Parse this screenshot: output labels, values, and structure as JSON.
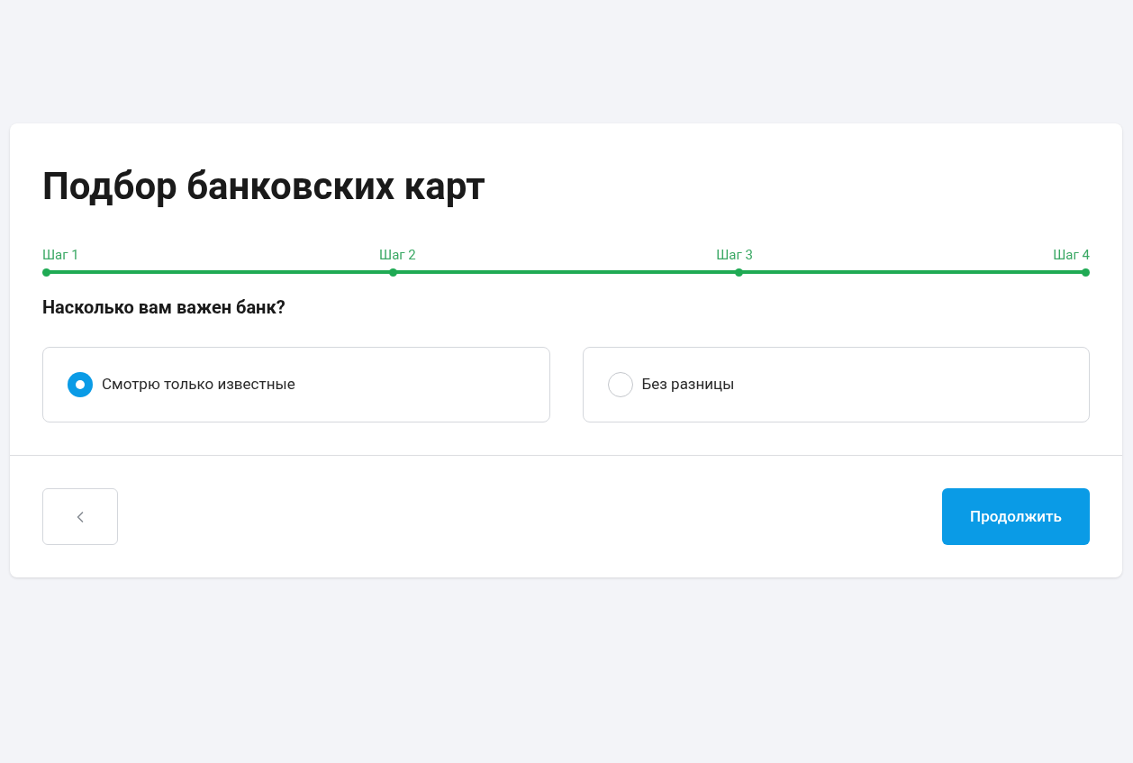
{
  "title": "Подбор банковских карт",
  "steps": [
    {
      "label": "Шаг 1",
      "completed": true
    },
    {
      "label": "Шаг 2",
      "completed": true
    },
    {
      "label": "Шаг 3",
      "completed": true
    },
    {
      "label": "Шаг 4",
      "completed": true
    }
  ],
  "question": "Насколько вам важен банк?",
  "options": [
    {
      "label": "Смотрю только известные",
      "selected": true
    },
    {
      "label": "Без разницы",
      "selected": false
    }
  ],
  "continue_button": "Продолжить"
}
